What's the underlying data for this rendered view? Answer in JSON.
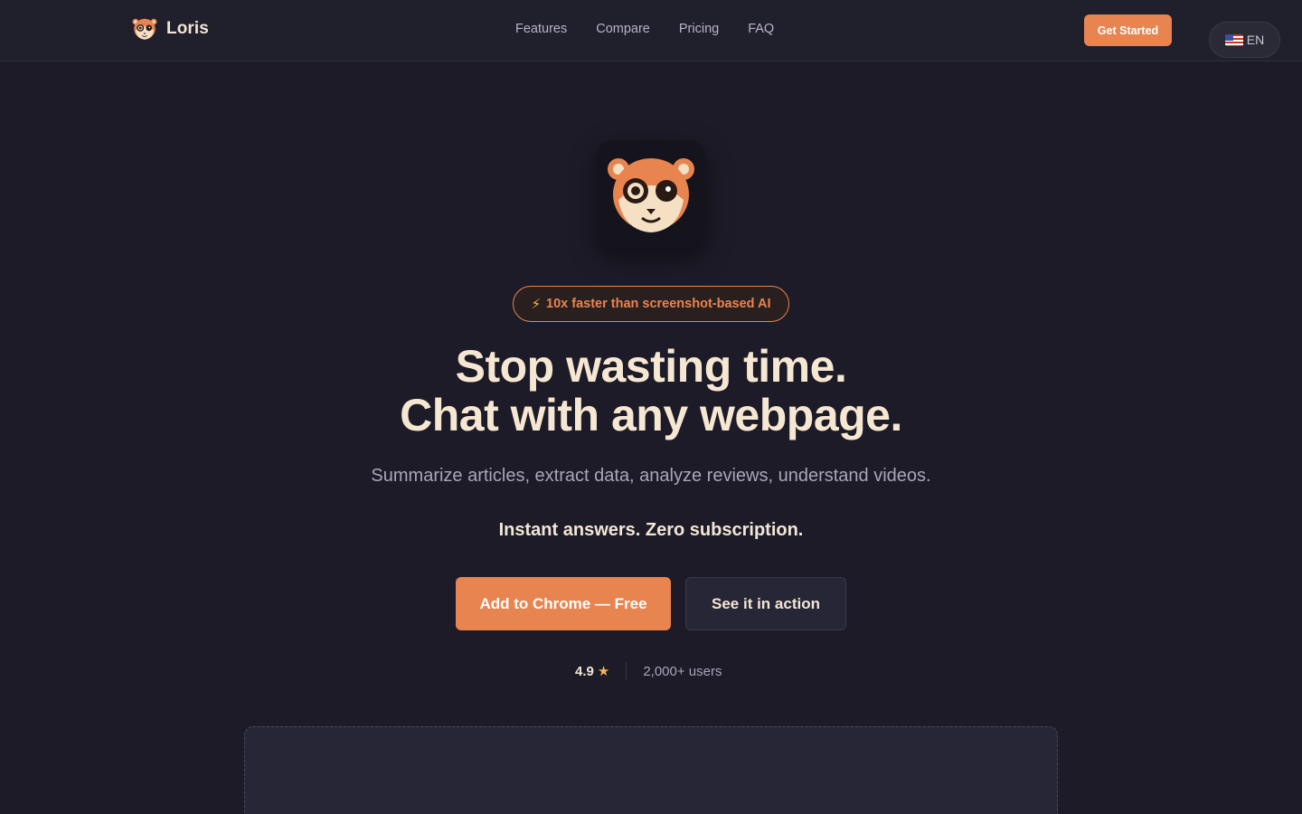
{
  "brand": {
    "name": "Loris",
    "logo_icon": "lemur-face-icon"
  },
  "nav": {
    "links": [
      "Features",
      "Compare",
      "Pricing",
      "FAQ"
    ],
    "cta_label": "Get Started",
    "language": {
      "flag": "us-flag-icon",
      "code": "EN"
    }
  },
  "hero": {
    "badge": {
      "icon": "⚡",
      "text": "10x faster than screenshot-based AI"
    },
    "headline_line1": "Stop wasting time.",
    "headline_line2": "Chat with any webpage.",
    "subtitle": "Summarize articles, extract data, analyze reviews, understand videos.",
    "subtitle_strong": "Instant answers. Zero subscription.",
    "primary_cta": "Add to Chrome — Free",
    "secondary_cta": "See it in action",
    "rating": "4.9",
    "rating_icon": "★",
    "users": "2,000+ users"
  },
  "colors": {
    "accent": "#e8844f",
    "background": "#1c1b27",
    "text": "#f6e7d3",
    "star": "#f2b84b"
  }
}
